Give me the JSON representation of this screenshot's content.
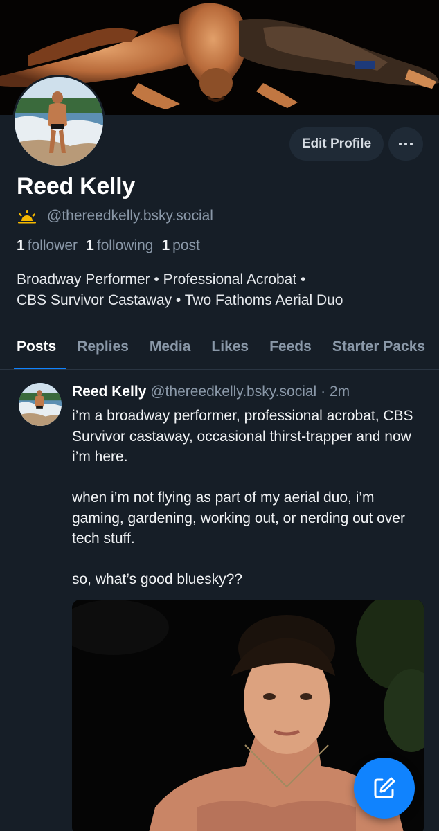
{
  "profile": {
    "display_name": "Reed Kelly",
    "handle": "@thereedkelly.bsky.social",
    "handle_icon": "sun-icon",
    "stats": [
      {
        "count": "1",
        "label": "follower"
      },
      {
        "count": "1",
        "label": "following"
      },
      {
        "count": "1",
        "label": "post"
      }
    ],
    "bio_lines": [
      "Broadway Performer • Professional Acrobat •",
      "CBS Survivor Castaway • Two Fathoms Aerial Duo"
    ]
  },
  "actions": {
    "edit_profile_label": "Edit Profile",
    "more_icon": "ellipsis-icon"
  },
  "tabs": [
    "Posts",
    "Replies",
    "Media",
    "Likes",
    "Feeds",
    "Starter Packs"
  ],
  "active_tab": "Posts",
  "post": {
    "author_name": "Reed Kelly",
    "author_handle": "@thereedkelly.bsky.social",
    "separator": "·",
    "time": "2m",
    "paragraphs": [
      "i’m a broadway performer, professional acrobat, CBS Survivor castaway, occasional thirst-trapper and now i’m here.",
      "when i’m not flying as part of my aerial duo, i’m gaming, gardening, working out, or nerding out over tech stuff.",
      "so, what’s good bluesky??"
    ]
  },
  "fab": {
    "icon": "compose-icon"
  },
  "colors": {
    "background": "#161e27",
    "accent": "#1083fe",
    "muted_text": "#8a98a8",
    "button_bg": "#1f2a36"
  }
}
